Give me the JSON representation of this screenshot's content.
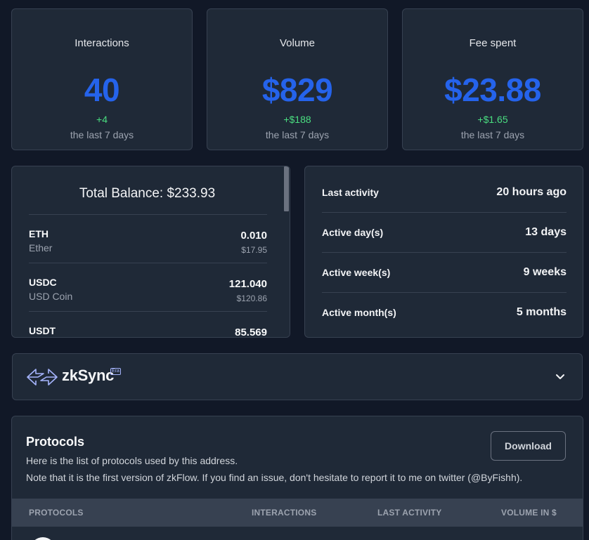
{
  "stats": [
    {
      "title": "Interactions",
      "value": "40",
      "delta": "+4",
      "period": "the last 7 days"
    },
    {
      "title": "Volume",
      "value": "$829",
      "delta": "+$188",
      "period": "the last 7 days"
    },
    {
      "title": "Fee spent",
      "value": "$23.88",
      "delta": "+$1.65",
      "period": "the last 7 days"
    }
  ],
  "balance": {
    "total_label": "Total Balance: $233.93",
    "tokens": [
      {
        "symbol": "ETH",
        "name": "Ether",
        "amount": "0.010",
        "usd": "$17.95"
      },
      {
        "symbol": "USDC",
        "name": "USD Coin",
        "amount": "121.040",
        "usd": "$120.86"
      },
      {
        "symbol": "USDT",
        "name": "",
        "amount": "85.569",
        "usd": ""
      }
    ]
  },
  "activity": [
    {
      "label": "Last activity",
      "value": "20 hours ago"
    },
    {
      "label": "Active day(s)",
      "value": "13 days"
    },
    {
      "label": "Active week(s)",
      "value": "9 weeks"
    },
    {
      "label": "Active month(s)",
      "value": "5 months"
    }
  ],
  "network": {
    "brand": "zkSync",
    "badge": "Era",
    "logo_icon": "zksync-arrows-icon",
    "toggle_icon": "chevron-down-icon"
  },
  "protocols": {
    "title": "Protocols",
    "description": "Here is the list of protocols used by this address.",
    "note": "Note that it is the first version of zkFlow. If you find an issue, don't hesitate to report it to me on twitter (@ByFishh).",
    "download_label": "Download",
    "columns": [
      "PROTOCOLS",
      "INTERACTIONS",
      "LAST ACTIVITY",
      "VOLUME IN $"
    ]
  },
  "colors": {
    "background": "#111827",
    "card": "#1f2937",
    "accent": "#2563eb",
    "positive": "#4ade80"
  }
}
